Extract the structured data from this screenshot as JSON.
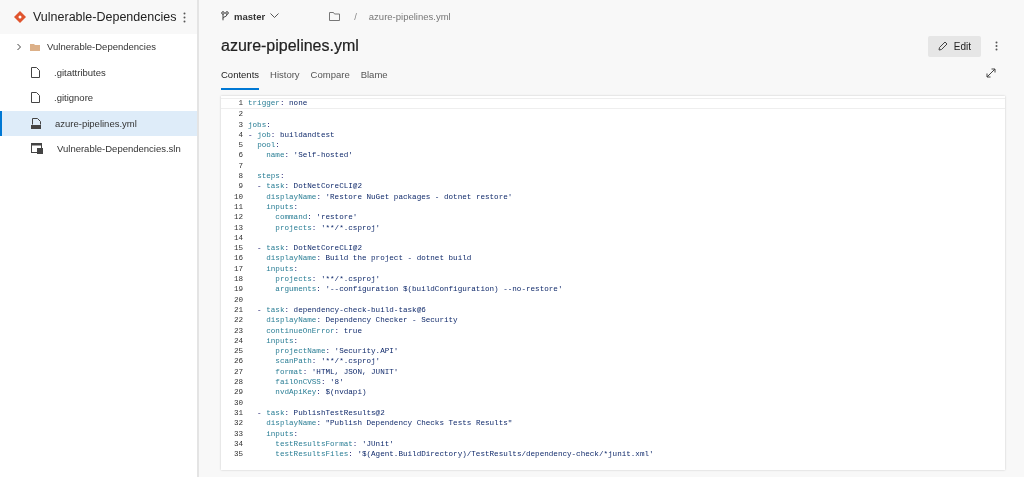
{
  "project": {
    "name": "Vulnerable-Dependencies"
  },
  "tree": [
    {
      "kind": "folder",
      "label": "Vulnerable-Dependencies",
      "expanded": false,
      "selected": false
    },
    {
      "kind": "file",
      "label": ".gitattributes",
      "selected": false
    },
    {
      "kind": "file",
      "label": ".gitignore",
      "selected": false
    },
    {
      "kind": "yaml",
      "label": "azure-pipelines.yml",
      "selected": true
    },
    {
      "kind": "solution",
      "label": "Vulnerable-Dependencies.sln",
      "selected": false
    }
  ],
  "branch": "master",
  "breadcrumb": {
    "separator": "/",
    "file": "azure-pipelines.yml"
  },
  "title": "azure-pipelines.yml",
  "edit_button": "Edit",
  "tabs": [
    {
      "label": "Contents",
      "selected": true
    },
    {
      "label": "History",
      "selected": false
    },
    {
      "label": "Compare",
      "selected": false
    },
    {
      "label": "Blame",
      "selected": false
    }
  ],
  "code": [
    {
      "number": "1",
      "text": "trigger: none"
    },
    {
      "number": "2"
    },
    {
      "number": "3",
      "text": "jobs:"
    },
    {
      "number": "4",
      "text": "- job: buildandtest"
    },
    {
      "number": "5",
      "text": "  pool:"
    },
    {
      "number": "6",
      "text": "    name: 'Self-hosted'"
    },
    {
      "number": "7"
    },
    {
      "number": "8",
      "text": "  steps:"
    },
    {
      "number": "9",
      "text": "  - task: DotNetCoreCLI@2"
    },
    {
      "number": "10",
      "text": "    displayName: 'Restore NuGet packages - dotnet restore'"
    },
    {
      "number": "11",
      "text": "    inputs:"
    },
    {
      "number": "12",
      "text": "      command: 'restore'"
    },
    {
      "number": "13",
      "text": "      projects: '**/*.csproj'"
    },
    {
      "number": "14"
    },
    {
      "number": "15",
      "text": "  - task: DotNetCoreCLI@2"
    },
    {
      "number": "16",
      "text": "    displayName: Build the project - dotnet build"
    },
    {
      "number": "17",
      "text": "    inputs:"
    },
    {
      "number": "18",
      "text": "      projects: '**/*.csproj'"
    },
    {
      "number": "19",
      "text": "      arguments: '--configuration $(buildConfiguration) --no-restore'"
    },
    {
      "number": "20"
    },
    {
      "number": "21",
      "text": "  - task: dependency-check-build-task@6"
    },
    {
      "number": "22",
      "text": "    displayName: Dependency Checker - Security"
    },
    {
      "number": "23",
      "text": "    continueOnError: true"
    },
    {
      "number": "24",
      "text": "    inputs:"
    },
    {
      "number": "25",
      "text": "      projectName: 'Security.API'"
    },
    {
      "number": "26",
      "text": "      scanPath: '**/*.csproj'"
    },
    {
      "number": "27",
      "text": "      format: 'HTML, JSON, JUNIT'"
    },
    {
      "number": "28",
      "text": "      failOnCVSS: '8'"
    },
    {
      "number": "29",
      "text": "      nvdApiKey: $(nvdapi)"
    },
    {
      "number": "30"
    },
    {
      "number": "31",
      "text": "  - task: PublishTestResults@2"
    },
    {
      "number": "32",
      "text": "    displayName: \"Publish Dependency Checks Tests Results\""
    },
    {
      "number": "33",
      "text": "    inputs:"
    },
    {
      "number": "34",
      "text": "      testResultsFormat: 'JUnit'"
    },
    {
      "number": "35",
      "text": "      testResultsFiles: '$(Agent.BuildDirectory)/TestResults/dependency-check/*junit.xml'"
    }
  ]
}
